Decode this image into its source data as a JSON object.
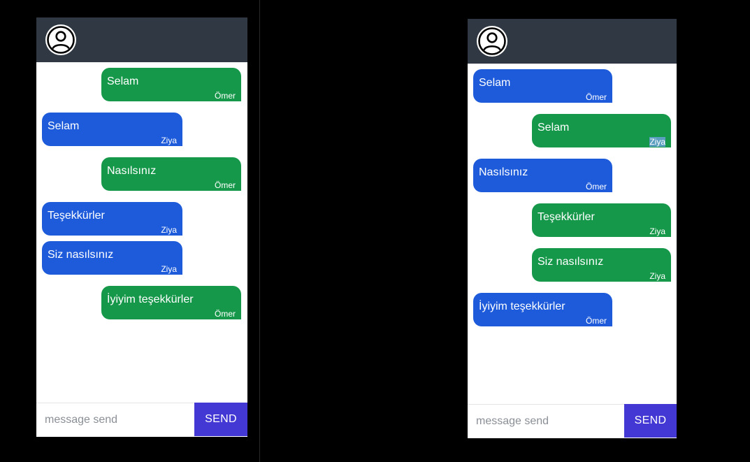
{
  "left_panel": {
    "messages": [
      {
        "text": "Selam",
        "sender": "Ömer",
        "side": "right",
        "color": "#16984a"
      },
      {
        "text": "Selam",
        "sender": "Ziya",
        "side": "left",
        "color": "#1d5bdb"
      },
      {
        "text": "Nasılsınız",
        "sender": "Ömer",
        "side": "right",
        "color": "#16984a"
      },
      {
        "text": "Teşekkürler",
        "sender": "Ziya",
        "side": "left",
        "color": "#1d5bdb"
      },
      {
        "text": "Siz nasılsınız",
        "sender": "Ziya",
        "side": "left",
        "color": "#1d5bdb"
      },
      {
        "text": "İyiyim teşekkürler",
        "sender": "Ömer",
        "side": "right",
        "color": "#16984a"
      }
    ],
    "input_placeholder": "message send",
    "send_label": "SEND"
  },
  "right_panel": {
    "messages": [
      {
        "text": "Selam",
        "sender": "Ömer",
        "side": "left",
        "color": "#1d5bdb"
      },
      {
        "text": "Selam",
        "sender": "Ziya",
        "side": "right",
        "color": "#16984a"
      },
      {
        "text": "Nasılsınız",
        "sender": "Ömer",
        "side": "left",
        "color": "#1d5bdb"
      },
      {
        "text": "Teşekkürler",
        "sender": "Ziya",
        "side": "right",
        "color": "#16984a"
      },
      {
        "text": "Siz nasılsınız",
        "sender": "Ziya",
        "side": "right",
        "color": "#16984a"
      },
      {
        "text": "İyiyim teşekkürler",
        "sender": "Ömer",
        "side": "left",
        "color": "#1d5bdb"
      }
    ],
    "input_placeholder": "message send",
    "send_label": "SEND"
  },
  "colors": {
    "header": "#2f3843",
    "own_bubble": "#16984a",
    "other_bubble": "#1d5bdb",
    "send_button": "#4338d4"
  },
  "icons": {
    "avatar": "user-circle-icon"
  }
}
